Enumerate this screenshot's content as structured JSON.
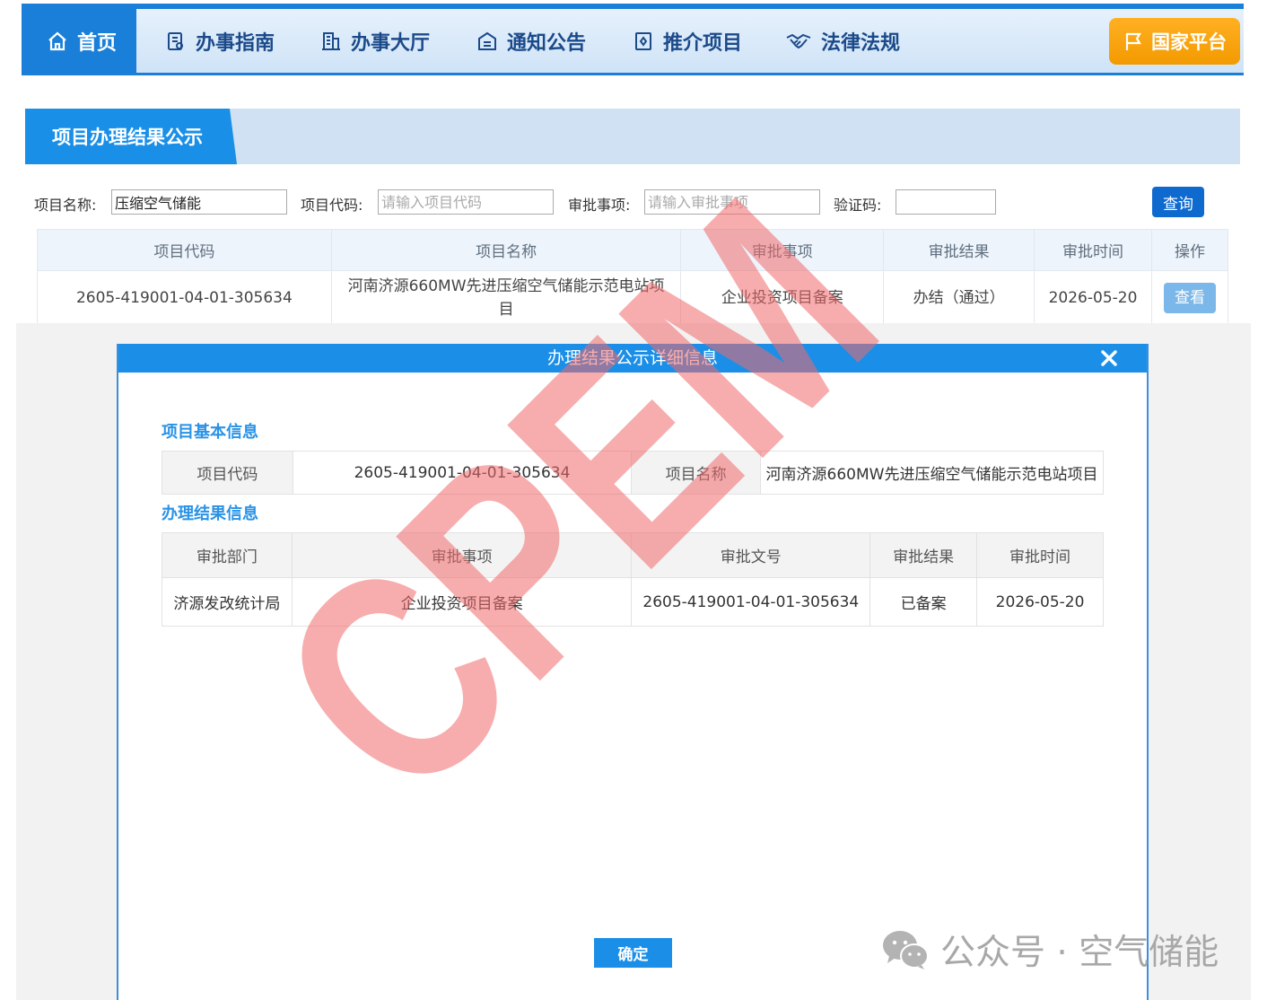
{
  "nav": {
    "items": [
      {
        "label": "首页",
        "icon": "home-icon"
      },
      {
        "label": "办事指南",
        "icon": "guide-doc-icon"
      },
      {
        "label": "办事大厅",
        "icon": "building-icon"
      },
      {
        "label": "通知公告",
        "icon": "notice-icon"
      },
      {
        "label": "推介项目",
        "icon": "project-icon"
      },
      {
        "label": "法律法规",
        "icon": "handshake-icon"
      }
    ],
    "cta_label": "国家平台",
    "cta_icon": "flag-icon"
  },
  "section": {
    "title": "项目办理结果公示"
  },
  "filters": {
    "name_label": "项目名称:",
    "name_value": "压缩空气储能",
    "code_label": "项目代码:",
    "code_placeholder": "请输入项目代码",
    "item_label": "审批事项:",
    "item_placeholder": "请输入审批事项",
    "captcha_label": "验证码:",
    "query_label": "查询"
  },
  "results": {
    "headers": [
      "项目代码",
      "项目名称",
      "审批事项",
      "审批结果",
      "审批时间",
      "操作"
    ],
    "rows": [
      {
        "code": "2605-419001-04-01-305634",
        "name": "河南济源660MW先进压缩空气储能示范电站项目",
        "item": "企业投资项目备案",
        "result": "办结（通过）",
        "time": "2026-05-20",
        "action": "查看"
      }
    ]
  },
  "modal": {
    "title": "办理结果公示详细信息",
    "basic_title": "项目基本信息",
    "basic": {
      "code_key": "项目代码",
      "code_val": "2605-419001-04-01-305634",
      "name_key": "项目名称",
      "name_val": "河南济源660MW先进压缩空气储能示范电站项目"
    },
    "result_title": "办理结果信息",
    "result_headers": [
      "审批部门",
      "审批事项",
      "审批文号",
      "审批结果",
      "审批时间"
    ],
    "result_row": [
      "济源发改统计局",
      "企业投资项目备案",
      "2605-419001-04-01-305634",
      "已备案",
      "2026-05-20"
    ],
    "ok_label": "确定"
  },
  "watermark": {
    "text": "CPEM",
    "color": "#f06a6a"
  },
  "footer_brand": {
    "text": "公众号 · 空气储能",
    "icon": "wechat-icon"
  },
  "colors": {
    "primary": "#1a7fd8",
    "accent": "#f39a00",
    "modal_head": "#1b8fe8"
  }
}
